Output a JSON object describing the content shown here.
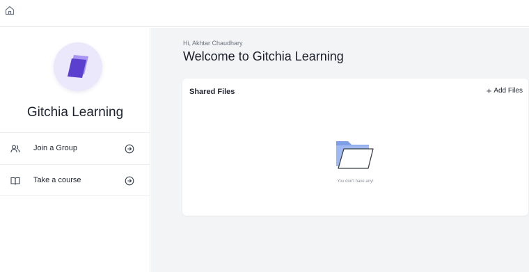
{
  "topbar": {
    "home_icon": "home-icon"
  },
  "sidebar": {
    "brand_name": "Gitchia Learning",
    "logo_color": "#6a4fd8",
    "items": [
      {
        "label": "Join a Group",
        "icon": "users-icon"
      },
      {
        "label": "Take a course",
        "icon": "book-icon"
      }
    ]
  },
  "main": {
    "greeting": "Hi, Akhtar Chaudhary",
    "welcome": "Welcome to Gitchia Learning",
    "shared_files": {
      "title": "Shared Files",
      "add_label": "Add Files",
      "empty_message": "You don't have any!"
    }
  },
  "colors": {
    "accent": "#6a4fd8",
    "folder": "#8aa9f0",
    "background": "#f3f4f6"
  }
}
